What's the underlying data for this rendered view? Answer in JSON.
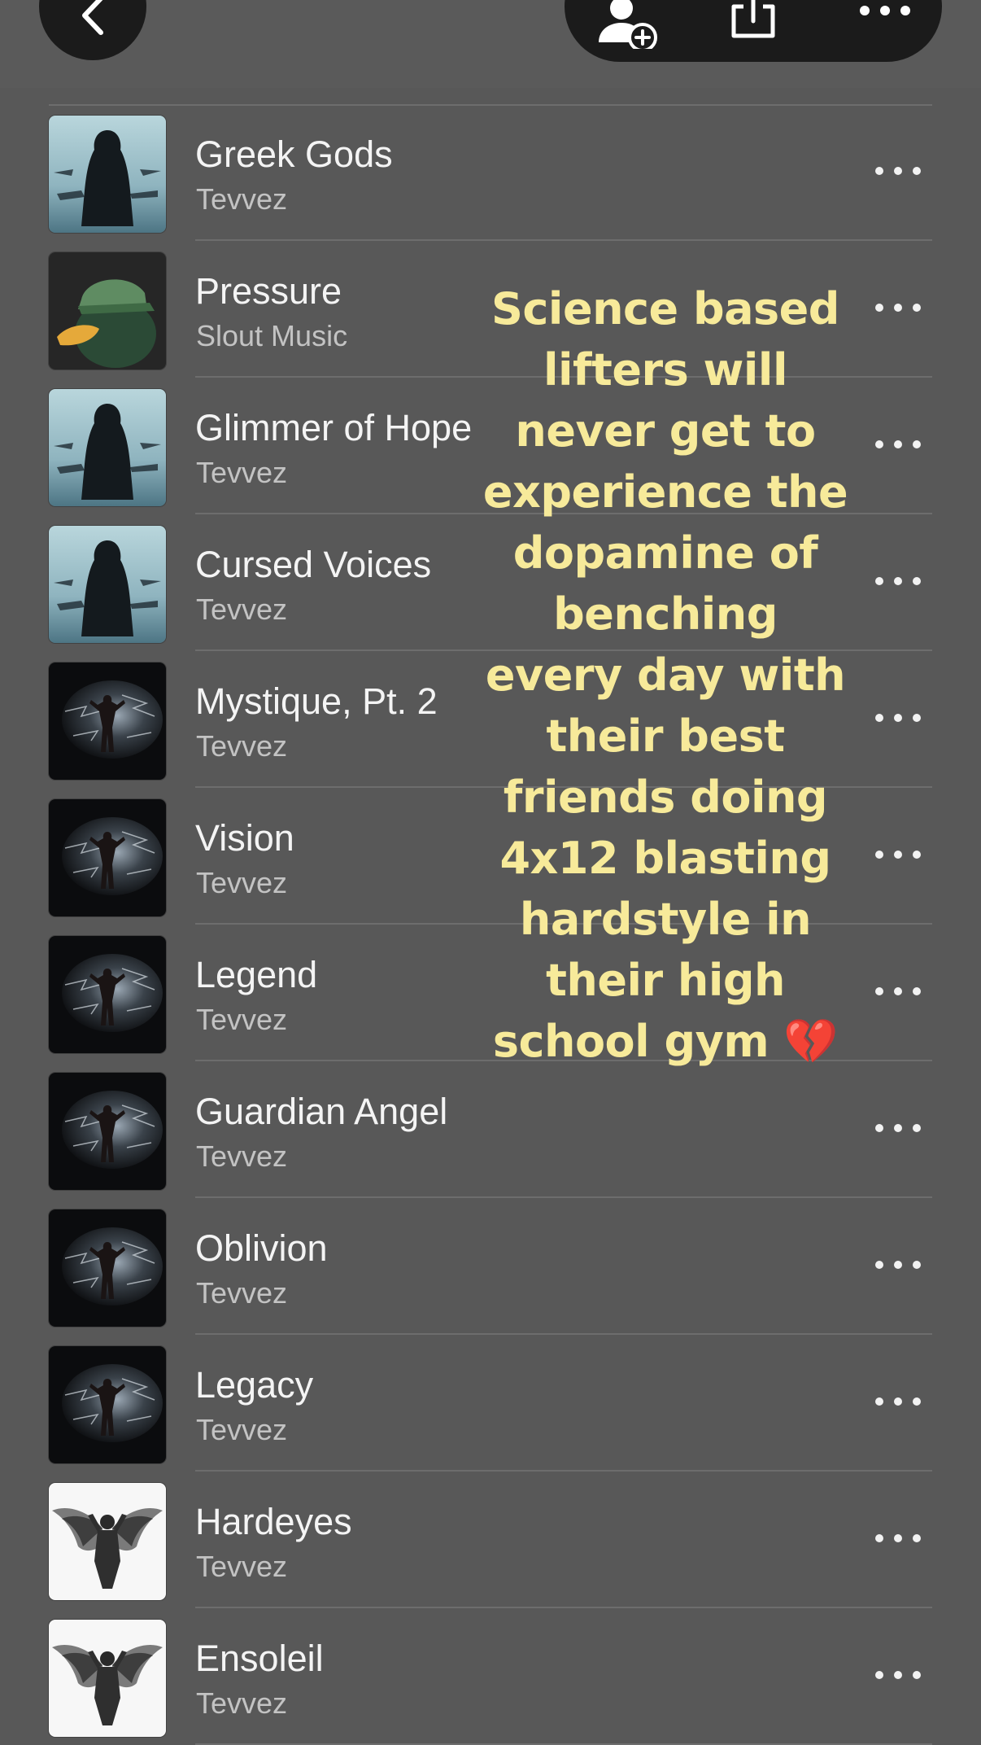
{
  "header": {
    "back_icon": "chevron-left-icon",
    "actions": [
      {
        "name": "add-person-icon"
      },
      {
        "name": "share-icon"
      },
      {
        "name": "more-horizontal-icon"
      }
    ]
  },
  "tracks": [
    {
      "title": "Greek Gods",
      "artist": "Tevvez",
      "art": "hooded-figure"
    },
    {
      "title": "Pressure",
      "artist": "Slout Music",
      "art": "duck-cap"
    },
    {
      "title": "Glimmer of Hope",
      "artist": "Tevvez",
      "art": "hooded-figure"
    },
    {
      "title": "Cursed Voices",
      "artist": "Tevvez",
      "art": "hooded-figure"
    },
    {
      "title": "Mystique, Pt. 2",
      "artist": "Tevvez",
      "art": "lightning-figure"
    },
    {
      "title": "Vision",
      "artist": "Tevvez",
      "art": "lightning-figure"
    },
    {
      "title": "Legend",
      "artist": "Tevvez",
      "art": "lightning-figure"
    },
    {
      "title": "Guardian Angel",
      "artist": "Tevvez",
      "art": "lightning-figure"
    },
    {
      "title": "Oblivion",
      "artist": "Tevvez",
      "art": "lightning-figure"
    },
    {
      "title": "Legacy",
      "artist": "Tevvez",
      "art": "lightning-figure"
    },
    {
      "title": "Hardeyes",
      "artist": "Tevvez",
      "art": "winged-figure"
    },
    {
      "title": "Ensoleil",
      "artist": "Tevvez",
      "art": "winged-figure"
    }
  ],
  "caption": {
    "text": "Science based lifters will never get to experience the dopamine of benching every day with their best friends doing 4x12 blasting hardstyle in their high school gym 💔",
    "color": "#f7ea9a"
  }
}
